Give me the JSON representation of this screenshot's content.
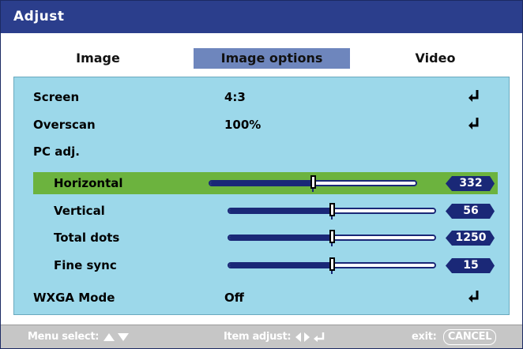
{
  "window": {
    "title": "Adjust"
  },
  "tabs": [
    {
      "label": "Image",
      "active": false
    },
    {
      "label": "Image options",
      "active": true
    },
    {
      "label": "Video",
      "active": false
    }
  ],
  "menu": {
    "screen": {
      "label": "Screen",
      "value": "4:3",
      "icon": "enter-icon"
    },
    "overscan": {
      "label": "Overscan",
      "value": "100%",
      "icon": "enter-icon"
    },
    "pc_adj": {
      "label": "PC adj."
    },
    "horizontal": {
      "label": "Horizontal",
      "value": "332",
      "slider_fraction": 0.5,
      "selected": true
    },
    "vertical": {
      "label": "Vertical",
      "value": "56",
      "slider_fraction": 0.5
    },
    "total_dots": {
      "label": "Total dots",
      "value": "1250",
      "slider_fraction": 0.5
    },
    "fine_sync": {
      "label": "Fine sync",
      "value": "15",
      "slider_fraction": 0.5
    },
    "wxga_mode": {
      "label": "WXGA Mode",
      "value": "Off",
      "icon": "enter-icon"
    }
  },
  "footer": {
    "menu_select": "Menu select:",
    "item_adjust": "Item adjust:",
    "exit": "exit:",
    "cancel": "CANCEL"
  },
  "colors": {
    "title_bar": "#2b3e8c",
    "active_tab": "#6e86bd",
    "panel": "#9cd8ea",
    "highlight": "#6cb33e",
    "slider": "#1a2877",
    "footer": "#c6c6c6"
  }
}
